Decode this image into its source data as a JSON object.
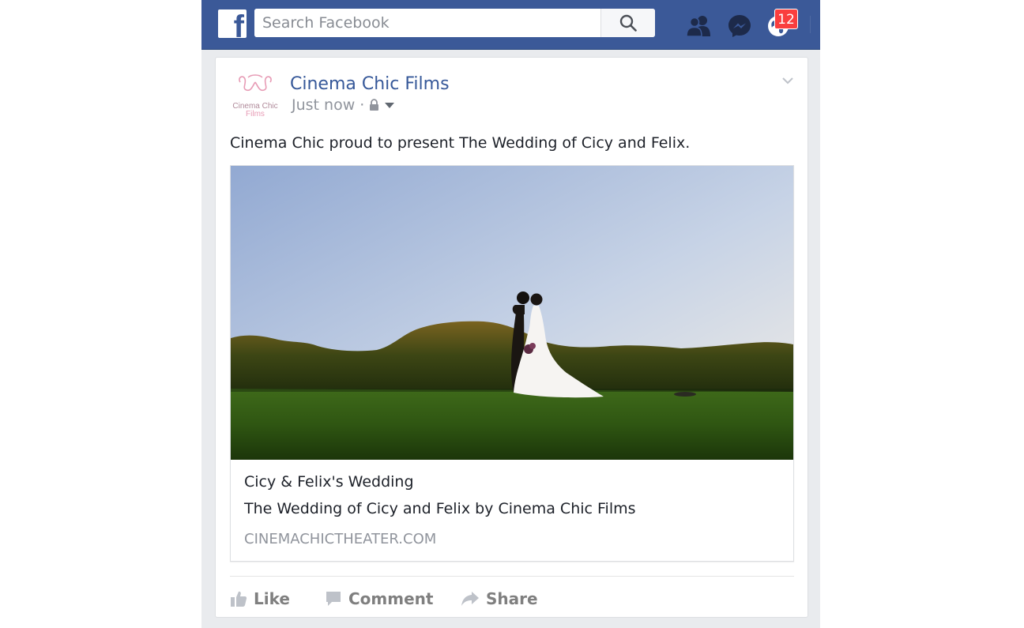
{
  "header": {
    "logo_letter": "f",
    "search_placeholder": "Search Facebook",
    "notifications_count": "12",
    "icons": [
      "search-icon",
      "friend-requests-icon",
      "messenger-icon",
      "notifications-globe-icon"
    ],
    "brand_color": "#3b5998",
    "badge_color": "#fa3e3e"
  },
  "post": {
    "page_name": "Cinema Chic Films",
    "avatar_text_line1": "Cinema Chic",
    "avatar_text_line2": "Films",
    "timestamp": "Just now",
    "separator": "·",
    "privacy_icon": "lock-icon",
    "text": "Cinema Chic proud to present The Wedding of Cicy and Felix.",
    "link": {
      "image_desc": "wedding-couple-on-lawn-at-sunset",
      "title": "Cicy & Felix's Wedding",
      "description": "The Wedding of Cicy and Felix by Cinema Chic Films",
      "domain": "CINEMACHICTHEATER.COM"
    },
    "actions": {
      "like": "Like",
      "comment": "Comment",
      "share": "Share"
    }
  }
}
